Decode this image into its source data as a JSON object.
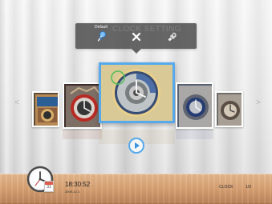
{
  "menu": {
    "watermark": "CLOCK SETTING",
    "default_label": "Default"
  },
  "navigation": {
    "left_arrow": "<",
    "right_arrow": ">"
  },
  "clock_widget": {
    "day": "31"
  },
  "footer": {
    "time": "18:30:52",
    "date": "2009-12-1",
    "category": "CLOCK",
    "page_count": "1/3"
  },
  "icons": {
    "pin": "pin-icon",
    "close": "close-icon",
    "launch": "rocket-icon",
    "play": "play-icon",
    "clock": "wall-clock-icon",
    "calendar": "calendar-icon"
  },
  "colors": {
    "selection": "#56a9ec",
    "menu_background": "#4e4e4e",
    "footer_wood": "#d7a072"
  }
}
